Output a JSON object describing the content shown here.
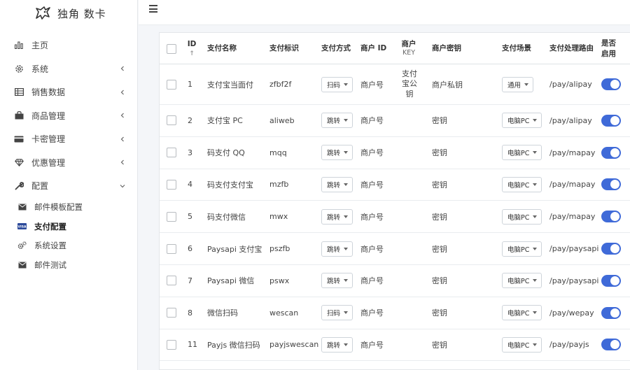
{
  "brand": {
    "name": "独角 数卡"
  },
  "topbar": {
    "menu_icon": "hamburger-icon"
  },
  "sidebar": {
    "items": [
      {
        "label": "主页",
        "icon": "bar-chart-icon",
        "expandable": false
      },
      {
        "label": "系统",
        "icon": "gear-icon",
        "expandable": true
      },
      {
        "label": "销售数据",
        "icon": "table-icon",
        "expandable": true
      },
      {
        "label": "商品管理",
        "icon": "shopping-bag-icon",
        "expandable": true
      },
      {
        "label": "卡密管理",
        "icon": "credit-card-icon",
        "expandable": true
      },
      {
        "label": "优惠管理",
        "icon": "diamond-icon",
        "expandable": true
      },
      {
        "label": "配置",
        "icon": "wrench-icon",
        "expandable": true,
        "expanded": true
      }
    ],
    "subitems": [
      {
        "label": "邮件模板配置",
        "icon": "envelope-icon"
      },
      {
        "label": "支付配置",
        "icon": "visa-card-icon",
        "active": true
      },
      {
        "label": "系统设置",
        "icon": "cogs-icon"
      },
      {
        "label": "邮件测试",
        "icon": "envelope-icon"
      }
    ]
  },
  "table": {
    "headers": {
      "id": "ID",
      "sort": "↑",
      "name": "支付名称",
      "code": "支付标识",
      "method": "支付方式",
      "merchant_id": "商户 ID",
      "merchant_key": "商户",
      "merchant_key_sub": "KEY",
      "merchant_secret": "商户密钥",
      "scene": "支付场景",
      "route": "支付处理路由",
      "enabled": "是否启用"
    },
    "rows": [
      {
        "id": "1",
        "name": "支付宝当面付",
        "code": "zfbf2f",
        "method": "扫码",
        "merchant_id": "商户号",
        "merchant_key": "支付宝公钥",
        "merchant_secret": "商户私钥",
        "scene": "通用",
        "route": "/pay/alipay",
        "enabled": true
      },
      {
        "id": "2",
        "name": "支付宝 PC",
        "code": "aliweb",
        "method": "跳转",
        "merchant_id": "商户号",
        "merchant_key": "",
        "merchant_secret": "密钥",
        "scene": "电脑PC",
        "route": "/pay/alipay",
        "enabled": true
      },
      {
        "id": "3",
        "name": "码支付 QQ",
        "code": "mqq",
        "method": "跳转",
        "merchant_id": "商户号",
        "merchant_key": "",
        "merchant_secret": "密钥",
        "scene": "电脑PC",
        "route": "/pay/mapay",
        "enabled": true
      },
      {
        "id": "4",
        "name": "码支付支付宝",
        "code": "mzfb",
        "method": "跳转",
        "merchant_id": "商户号",
        "merchant_key": "",
        "merchant_secret": "密钥",
        "scene": "电脑PC",
        "route": "/pay/mapay",
        "enabled": true
      },
      {
        "id": "5",
        "name": "码支付微信",
        "code": "mwx",
        "method": "跳转",
        "merchant_id": "商户号",
        "merchant_key": "",
        "merchant_secret": "密钥",
        "scene": "电脑PC",
        "route": "/pay/mapay",
        "enabled": true
      },
      {
        "id": "6",
        "name": "Paysapi 支付宝",
        "code": "pszfb",
        "method": "跳转",
        "merchant_id": "商户号",
        "merchant_key": "",
        "merchant_secret": "密钥",
        "scene": "电脑PC",
        "route": "/pay/paysapi",
        "enabled": true
      },
      {
        "id": "7",
        "name": "Paysapi 微信",
        "code": "pswx",
        "method": "跳转",
        "merchant_id": "商户号",
        "merchant_key": "",
        "merchant_secret": "密钥",
        "scene": "电脑PC",
        "route": "/pay/paysapi",
        "enabled": true
      },
      {
        "id": "8",
        "name": "微信扫码",
        "code": "wescan",
        "method": "扫码",
        "merchant_id": "商户号",
        "merchant_key": "",
        "merchant_secret": "密钥",
        "scene": "电脑PC",
        "route": "/pay/wepay",
        "enabled": true
      },
      {
        "id": "11",
        "name": "Payjs 微信扫码",
        "code": "payjswescan",
        "method": "跳转",
        "merchant_id": "商户号",
        "merchant_key": "",
        "merchant_secret": "密钥",
        "scene": "电脑PC",
        "route": "/pay/payjs",
        "enabled": true
      }
    ]
  },
  "colors": {
    "accent": "#3f6ad8",
    "sidebar_bg": "#ffffff",
    "page_bg": "#f4f6f9"
  }
}
